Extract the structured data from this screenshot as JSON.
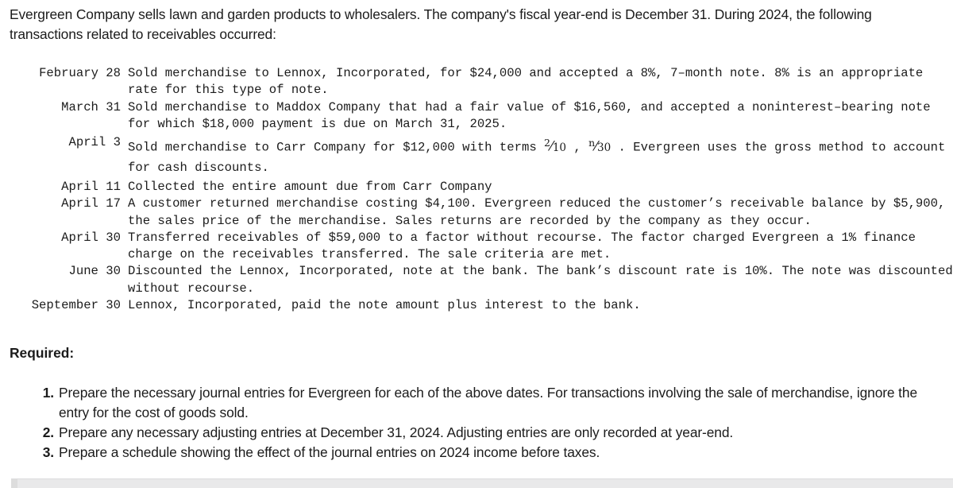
{
  "intro": {
    "line1": "Evergreen Company sells lawn and garden products to wholesalers. The company's fiscal year-end is December 31.",
    "line2": "During 2024, the following transactions related to receivables occurred:"
  },
  "transactions": [
    {
      "date": "February 28",
      "description": "Sold merchandise to Lennox, Incorporated, for $24,000 and accepted a 8%, 7–month note. 8% is an appropriate rate for this type of note."
    },
    {
      "date": "March 31",
      "description": "Sold merchandise to Maddox Company that had a fair value of $16,560, and accepted a noninterest–bearing note for which $18,000 payment is due on March 31, 2025."
    },
    {
      "date": "April 3",
      "description_pre": "Sold merchandise to Carr Company for $12,000 with terms ",
      "fraction1_num": "2",
      "fraction1_den": "10",
      "description_mid": " , ",
      "fraction2_num": "n",
      "fraction2_den": "30",
      "description_post": " . Evergreen uses the gross method to account for cash discounts."
    },
    {
      "date": "April 11",
      "description": "Collected the entire amount due from Carr Company"
    },
    {
      "date": "April 17",
      "description": "A customer returned merchandise costing $4,100. Evergreen reduced the customer’s receivable balance by $5,900, the sales price of the merchandise. Sales returns are recorded by the company as they occur."
    },
    {
      "date": "April 30",
      "description": "Transferred receivables of $59,000 to a factor without recourse. The factor charged Evergreen a 1% finance charge on the receivables transferred. The sale criteria are met."
    },
    {
      "date": "June 30",
      "description": "Discounted the Lennox, Incorporated, note at the bank. The bank’s discount rate is 10%. The note was discounted without recourse."
    },
    {
      "date": "September 30",
      "description": "Lennox, Incorporated, paid the note amount plus interest to the bank."
    }
  ],
  "required": {
    "heading": "Required:",
    "items": [
      {
        "number": "1.",
        "text": "Prepare the necessary journal entries for Evergreen for each of the above dates. For transactions involving the sale of merchandise, ignore the entry for the cost of goods sold."
      },
      {
        "number": "2.",
        "text": "Prepare any necessary adjusting entries at December 31, 2024. Adjusting entries are only recorded at year-end."
      },
      {
        "number": "3.",
        "text": "Prepare a schedule showing the effect of the journal entries on 2024 income before taxes."
      }
    ]
  },
  "colors": {
    "text": "#1b1b1b",
    "background": "#ffffff",
    "scrollbar_track": "#e9e9ea",
    "scrollbar_thumb": "#dddddd"
  }
}
